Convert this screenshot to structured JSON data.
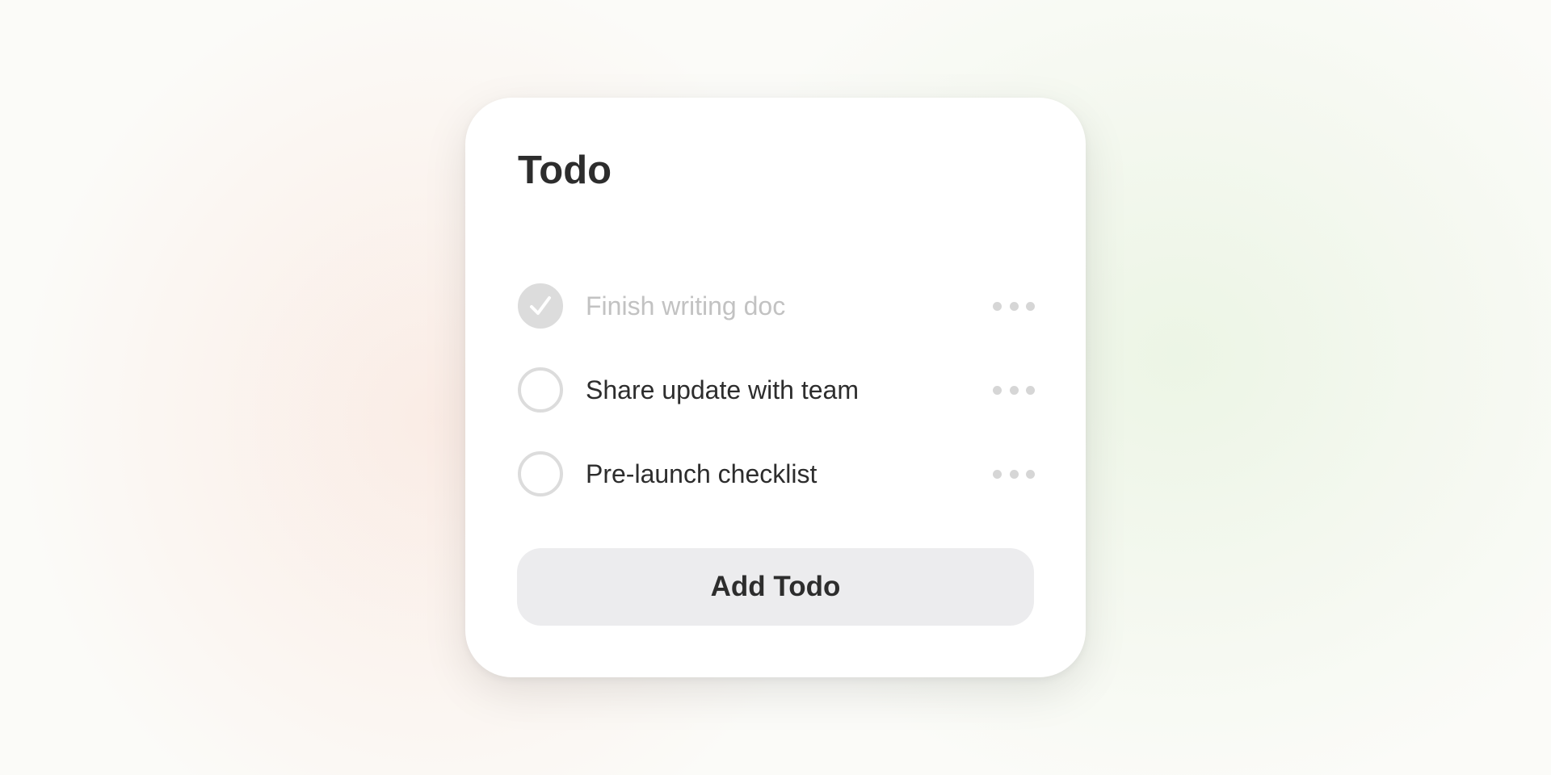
{
  "card": {
    "title": "Todo"
  },
  "todos": [
    {
      "label": "Finish writing doc",
      "completed": true
    },
    {
      "label": "Share update with team",
      "completed": false
    },
    {
      "label": "Pre-launch checklist",
      "completed": false
    }
  ],
  "add_button": {
    "label": "Add Todo"
  },
  "icons": {
    "checkbox_checked": "check-icon",
    "item_menu": "more-horizontal-icon"
  },
  "colors": {
    "text": "#2d2d2d",
    "completed_text": "#c2c2c2",
    "checkbox": "#dcdcdc",
    "button_bg": "#ececee",
    "card_bg": "#ffffff"
  }
}
